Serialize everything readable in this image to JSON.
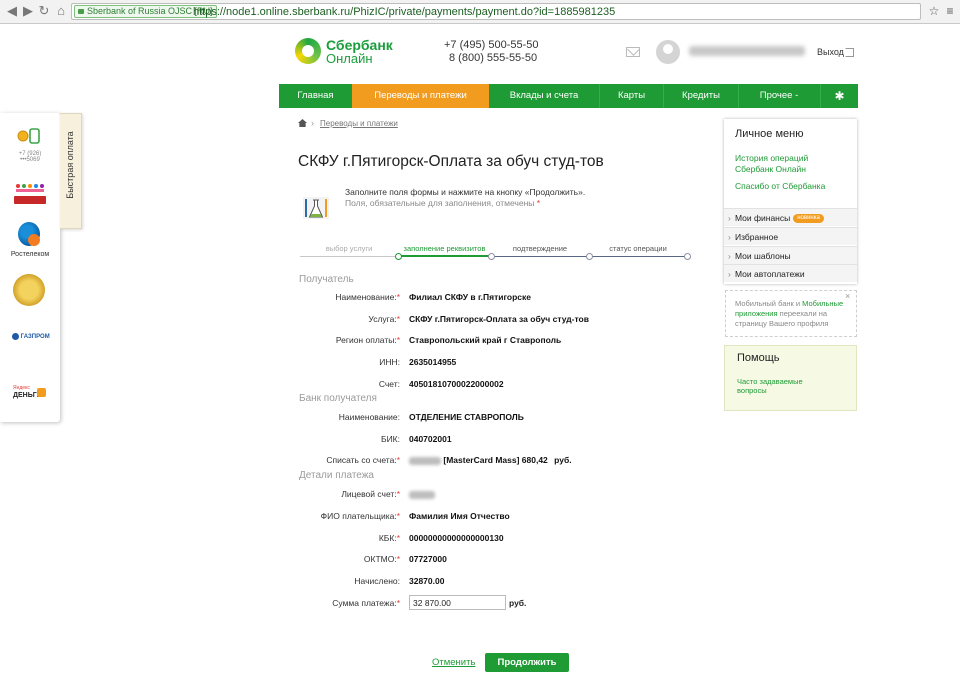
{
  "browser": {
    "cert_label": "Sberbank of Russia OJSC [RU]",
    "url": "https://node1.online.sberbank.ru/PhizIC/private/payments/payment.do?id=1885981235",
    "back_icon": "arrow-left-icon",
    "forward_icon": "arrow-right-icon",
    "reload_icon": "reload-icon",
    "home_icon": "home-icon"
  },
  "header": {
    "logo_line1": "Сбербанк",
    "logo_line2": "Онлайн",
    "phone1_prefix": "+7 (495)",
    "phone1_number": "500-55-50",
    "phone2_prefix": "8 (800)",
    "phone2_number": "555-55-50",
    "logout": "Выход",
    "brand_color": "#1e9b35",
    "accent_color": "#f29c1f"
  },
  "nav": {
    "items": [
      {
        "label": "Главная"
      },
      {
        "label": "Переводы и платежи"
      },
      {
        "label": "Вклады и счета"
      },
      {
        "label": "Карты"
      },
      {
        "label": "Кредиты"
      },
      {
        "label": "Прочее -"
      }
    ],
    "settings_icon": "gear-icon"
  },
  "quick_pay": {
    "tab_label": "Быстрая оплата",
    "phone_caption": "+7 (926) •••5069",
    "rostelecom_caption": "Ростелеком",
    "gazprom_caption": "ГАЗПРОМ",
    "yandex_line1": "Яндекс",
    "yandex_line2": "ДЕНЬГИ"
  },
  "breadcrumb": {
    "link": "Переводы и платежи"
  },
  "page_title": "СКФУ г.Пятигорск-Оплата за обуч студ-тов",
  "hint": {
    "line1": "Заполните поля формы и нажмите на кнопку «Продолжить».",
    "line2": "Поля, обязательные для заполнения, отмечены",
    "mark": "*"
  },
  "steps": {
    "items": [
      "выбор услуги",
      "заполнение реквизитов",
      "подтверждение",
      "статус операции"
    ],
    "current": 1
  },
  "form": {
    "section_recipient": "Получатель",
    "section_bank": "Банк получателя",
    "section_details": "Детали платежа",
    "recipient": {
      "name_label": "Наименование:",
      "name_value": "Филиал СКФУ в г.Пятигорске",
      "service_label": "Услуга:",
      "service_value": "СКФУ г.Пятигорск-Оплата за обуч студ-тов",
      "region_label": "Регион оплаты:",
      "region_value": "Ставропольский край г Ставрополь",
      "inn_label": "ИНН:",
      "inn_value": "2635014955",
      "account_label": "Счет:",
      "account_value": "40501810700022000002"
    },
    "bank": {
      "name_label": "Наименование:",
      "name_value": "ОТДЕЛЕНИЕ СТАВРОПОЛЬ",
      "bik_label": "БИК:",
      "bik_value": "040702001",
      "debit_label": "Списать со счета:",
      "debit_value": "[MasterCard Mass] 680,42",
      "debit_unit": "руб."
    },
    "details": {
      "personal_account_label": "Лицевой счет:",
      "payer_label": "ФИО плательщика:",
      "payer_value": "Фамилия Имя Отчество",
      "kbk_label": "КБК:",
      "kbk_value": "00000000000000000130",
      "oktmo_label": "ОКТМО:",
      "oktmo_value": "07727000",
      "charged_label": "Начислено:",
      "charged_value": "32870.00",
      "sum_label": "Сумма платежа:",
      "sum_value": "32 870.00",
      "sum_unit": "руб."
    },
    "required_mark": "*"
  },
  "actions": {
    "cancel": "Отменить",
    "continue": "Продолжить"
  },
  "personal_menu": {
    "title": "Личное меню",
    "link_history_1": "История операций",
    "link_history_2": "Сбербанк Онлайн",
    "link_thanks": "Спасибо от Сбербанка",
    "items": [
      {
        "label": "Мои финансы",
        "badge": "новинка"
      },
      {
        "label": "Избранное"
      },
      {
        "label": "Мои шаблоны"
      },
      {
        "label": "Мои автоплатежи"
      }
    ]
  },
  "notice": {
    "pre": "Мобильный банк и ",
    "link": "Мобильные приложения",
    "post": " переехали на страницу Вашего профиля",
    "close": "×"
  },
  "help": {
    "title": "Помощь",
    "link": "Часто задаваемые вопросы"
  }
}
